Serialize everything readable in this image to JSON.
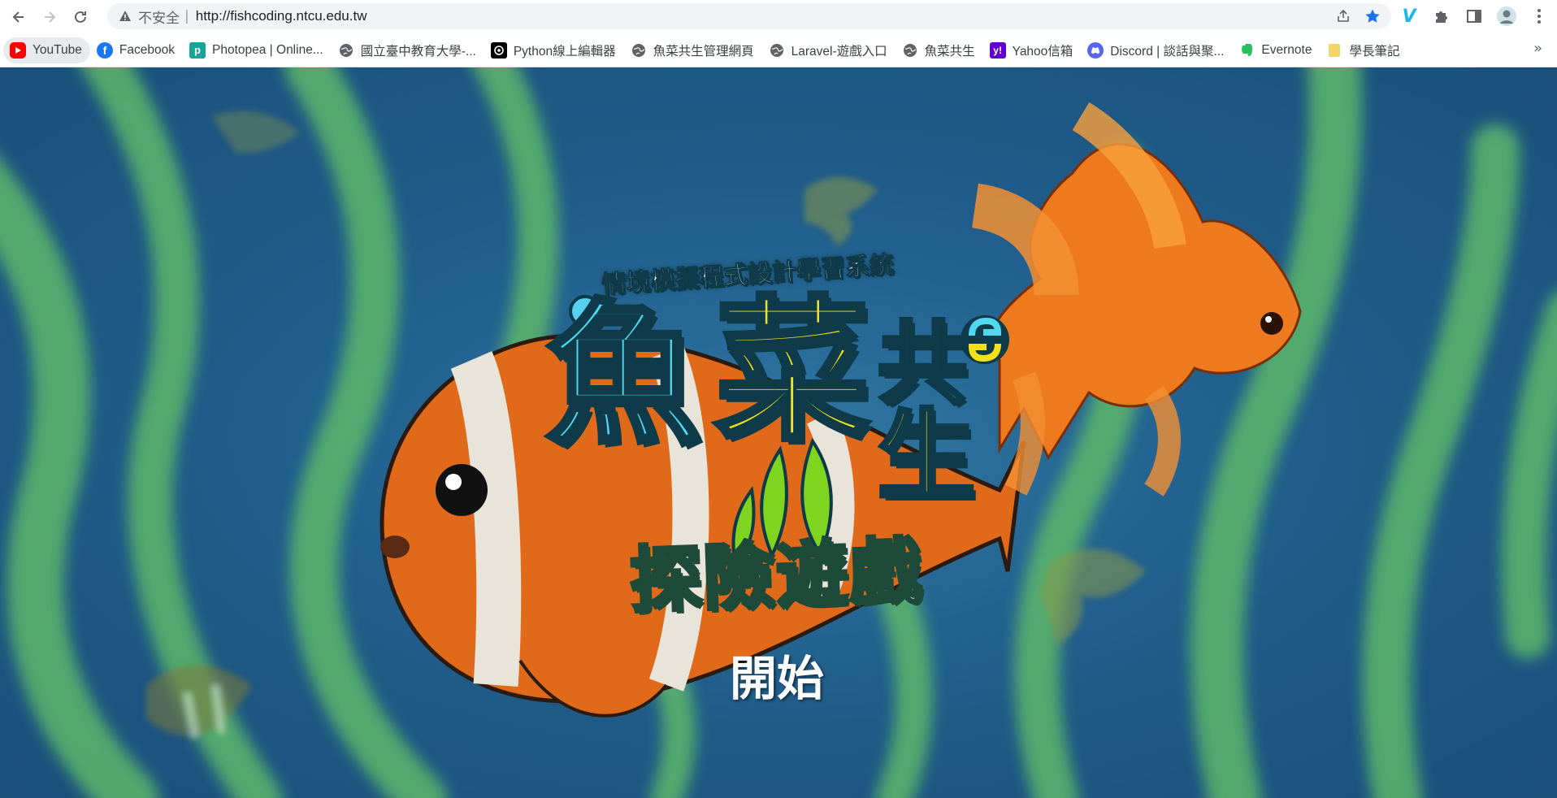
{
  "browser": {
    "security_label": "不安全",
    "url_separator": "|",
    "url": "http://fishcoding.ntcu.edu.tw",
    "icons": {
      "back": "back-arrow-icon",
      "forward": "forward-arrow-icon",
      "reload": "reload-icon",
      "share": "share-icon",
      "bookmark_star": "star-icon",
      "extension_v": "vimeo-icon",
      "extensions": "puzzle-icon",
      "side_panel": "side-panel-icon",
      "profile": "avatar",
      "menu": "kebab-menu-icon"
    },
    "star_color": "#1a73e8"
  },
  "bookmarks": [
    {
      "label": "YouTube",
      "icon": "youtube-icon",
      "color": "#ff0000"
    },
    {
      "label": "Facebook",
      "icon": "facebook-icon",
      "color": "#1877f2"
    },
    {
      "label": "Photopea | Online...",
      "icon": "photopea-icon",
      "color": "#18a497"
    },
    {
      "label": "國立臺中教育大學-...",
      "icon": "globe-icon",
      "color": "#5f6368"
    },
    {
      "label": "Python線上編輯器",
      "icon": "python-editor-icon",
      "color": "#000000"
    },
    {
      "label": "魚菜共生管理網頁",
      "icon": "globe-icon",
      "color": "#5f6368"
    },
    {
      "label": "Laravel-遊戲入口",
      "icon": "globe-icon",
      "color": "#5f6368"
    },
    {
      "label": "魚菜共生",
      "icon": "globe-icon",
      "color": "#5f6368"
    },
    {
      "label": "Yahoo信箱",
      "icon": "yahoo-icon",
      "color": "#6001d2"
    },
    {
      "label": "Discord | 談話與聚...",
      "icon": "discord-icon",
      "color": "#5865f2"
    },
    {
      "label": "Evernote",
      "icon": "evernote-icon",
      "color": "#2dbe60"
    },
    {
      "label": "學長筆記",
      "icon": "folder-icon",
      "color": "#f6d46b"
    }
  ],
  "bookmarks_overflow": "»",
  "game": {
    "tagline": "情境模擬程式設計學習系統",
    "title_chars": [
      "魚",
      "菜",
      "共",
      "生"
    ],
    "subtitle": "探險遊戲",
    "start_label": "開始",
    "colors": {
      "title_cyan": "#4fd8f0",
      "title_yellow": "#f5e11a",
      "outline": "#0e3a4a",
      "water": "#215f8e",
      "seaweed": "#5bb86a"
    }
  }
}
